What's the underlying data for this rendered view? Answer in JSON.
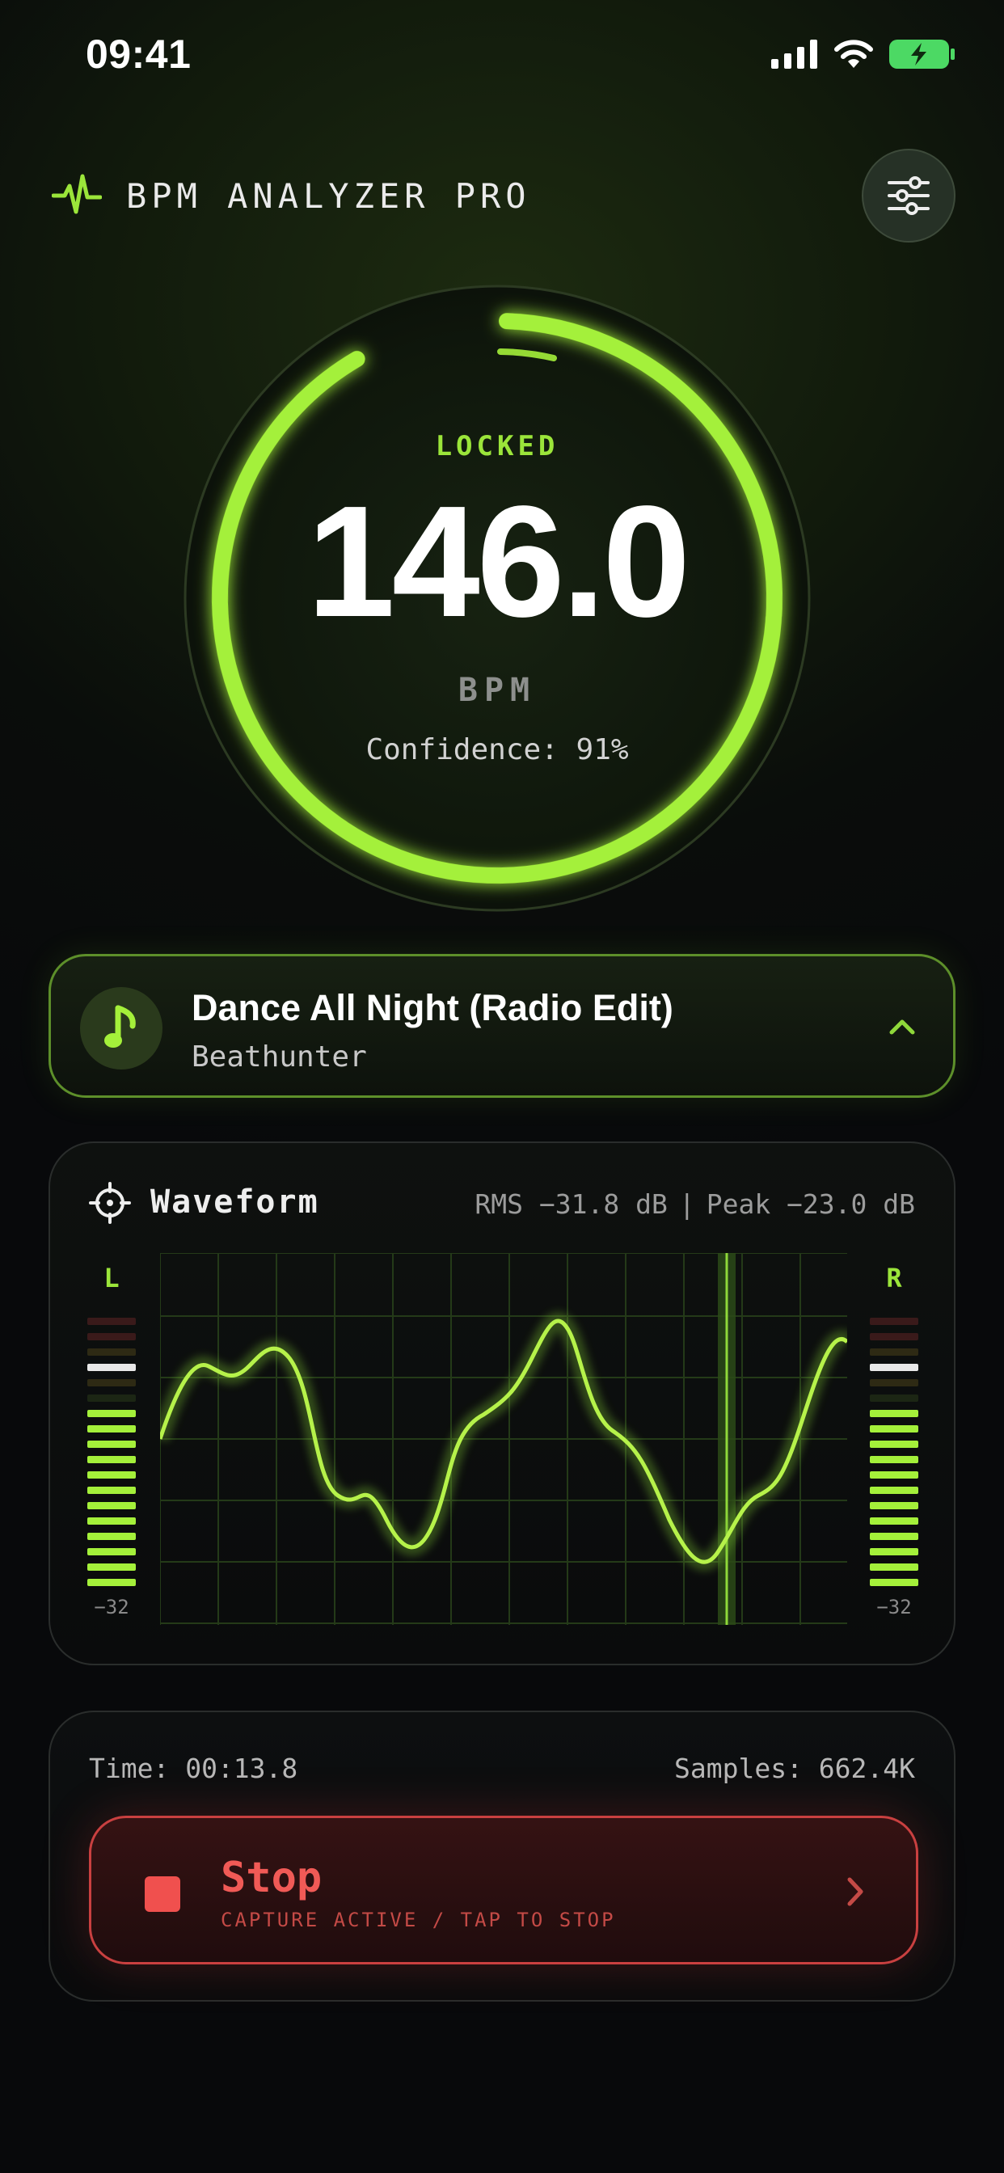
{
  "status_bar": {
    "time": "09:41",
    "icons": [
      "cellular-signal-icon",
      "wifi-icon",
      "battery-charging-icon"
    ]
  },
  "header": {
    "title": "BPM ANALYZER PRO",
    "logo_icon": "heartbeat-pulse-icon",
    "settings_icon": "sliders-icon"
  },
  "gauge": {
    "status": "LOCKED",
    "bpm": "146.0",
    "unit": "BPM",
    "confidence": "Confidence: 91%",
    "confidence_value": 0.91,
    "accent_color": "#a4f03a"
  },
  "track": {
    "title": "Dance All Night (Radio Edit)",
    "artist": "Beathunter",
    "icon": "music-note-icon",
    "toggle_icon": "chevron-up-icon"
  },
  "waveform": {
    "title": "Waveform",
    "icon": "crosshair-icon",
    "rms": "RMS −31.8 dB",
    "separator": "|",
    "peak": "Peak −23.0 dB",
    "left_meter": {
      "label": "L",
      "scale": "−32",
      "level": 0.64
    },
    "right_meter": {
      "label": "R",
      "scale": "−32",
      "level": 0.64
    }
  },
  "controls": {
    "time": "Time: 00:13.8",
    "samples": "Samples: 662.4K",
    "stop_label": "Stop",
    "stop_sub": "CAPTURE ACTIVE / TAP TO STOP",
    "stop_color": "#f05a56"
  }
}
